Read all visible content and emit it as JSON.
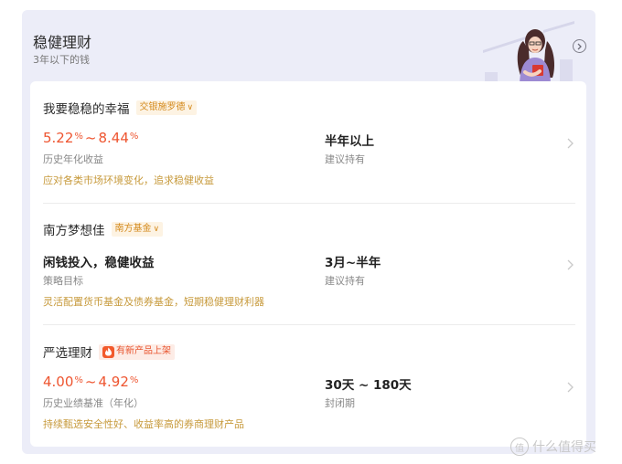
{
  "header": {
    "title": "稳健理财",
    "subtitle": "3年以下的钱"
  },
  "products": [
    {
      "name": "我要稳稳的幸福",
      "tag": "交银施罗德",
      "tag_chevron": "∨",
      "rate_low": "5.22",
      "rate_high": "8.44",
      "pct": "%",
      "tilde": "~",
      "left_label": "历史年化收益",
      "right_value": "半年以上",
      "right_label": "建议持有",
      "description": "应对各类市场环境变化，追求稳健收益"
    },
    {
      "name": "南方梦想佳",
      "tag": "南方基金",
      "tag_chevron": "∨",
      "left_value": "闲钱投入，稳健收益",
      "left_label": "策略目标",
      "right_value": "3月~半年",
      "right_label": "建议持有",
      "description": "灵活配置货币基金及债券基金，短期稳健理财利器"
    },
    {
      "name": "严选理财",
      "tag": "有新产品上架",
      "rate_low": "4.00",
      "rate_high": "4.92",
      "pct": "%",
      "tilde": "~",
      "left_label": "历史业绩基准（年化）",
      "right_value": "30天 ~ 180天",
      "right_label": "封闭期",
      "description": "持续甄选安全性好、收益率高的券商理财产品"
    }
  ],
  "watermark": {
    "icon_text": "值",
    "text": "什么值得买"
  },
  "colors": {
    "panel_bg": "#ecedf8",
    "rate_red": "#ee5530",
    "tag_gold": "#d48a1c",
    "desc_gold": "#c79a3c"
  },
  "icons": [
    "chevron-right-circle-icon",
    "chevron-right-icon",
    "fire-icon",
    "woman-illustration",
    "zhide-logo-icon"
  ]
}
